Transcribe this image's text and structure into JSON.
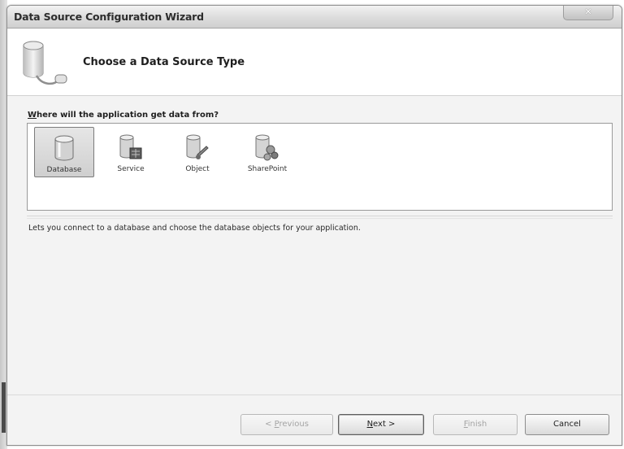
{
  "window": {
    "title": "Data Source Configuration Wizard",
    "close_glyph": "✕"
  },
  "header": {
    "title": "Choose a Data Source Type",
    "icon": "database-connection-icon"
  },
  "prompt": {
    "mnemonic": "W",
    "rest": "here will the application get data from?"
  },
  "sources": {
    "selected": "Database",
    "items": [
      {
        "label": "Database",
        "icon": "database-icon"
      },
      {
        "label": "Service",
        "icon": "service-icon"
      },
      {
        "label": "Object",
        "icon": "object-icon"
      },
      {
        "label": "SharePoint",
        "icon": "sharepoint-icon"
      }
    ]
  },
  "description": "Lets you connect to a database and choose the database objects for your application.",
  "buttons": {
    "previous": {
      "mnemonic": "",
      "prefix": "< ",
      "underlined": "P",
      "rest": "revious",
      "enabled": false
    },
    "next": {
      "underlined": "N",
      "rest": "ext >",
      "enabled": true
    },
    "finish": {
      "underlined": "F",
      "rest": "inish",
      "enabled": false
    },
    "cancel": {
      "label": "Cancel",
      "enabled": true
    }
  }
}
